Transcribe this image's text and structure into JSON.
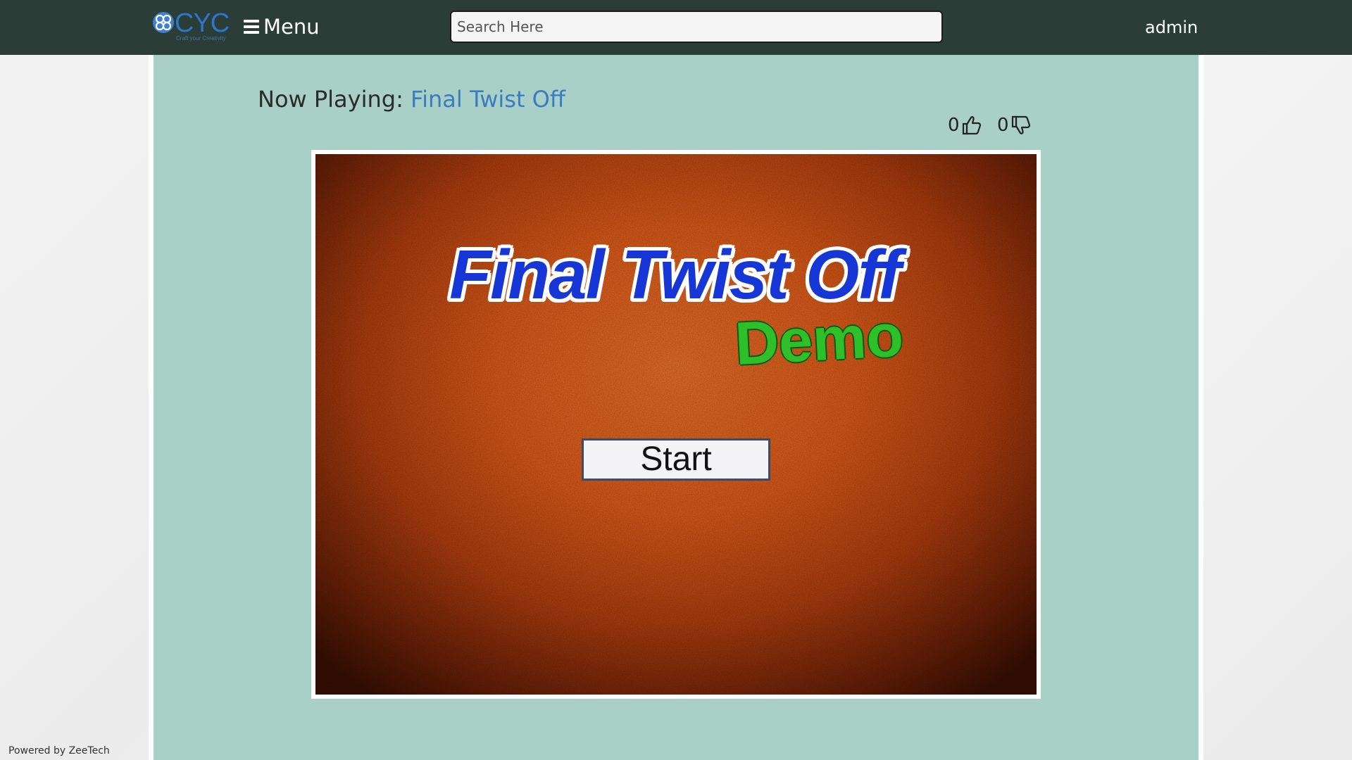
{
  "navbar": {
    "logo_text": "CYC",
    "logo_tagline": "Craft your Creativity",
    "menu_label": "Menu",
    "search_placeholder": "Search Here",
    "search_value": "",
    "user_name": "admin"
  },
  "player": {
    "now_playing_label": "Now Playing: ",
    "game_title": "Final Twist Off",
    "likes": "0",
    "dislikes": "0"
  },
  "game_screen": {
    "title": "Final Twist Off",
    "subtitle": "Demo",
    "start_button": "Start"
  },
  "footer": {
    "powered_by": "Powered by ZeeTech"
  },
  "colors": {
    "navbar": "#2a3d36",
    "content_bg": "#a9d0c6",
    "link": "#3b7bbf",
    "game_title": "#1636d6",
    "game_subtitle": "#2fbf2a"
  },
  "icons": {
    "logo": "flower-logo-icon",
    "menu": "hamburger-icon",
    "like": "thumbs-up-icon",
    "dislike": "thumbs-down-icon"
  }
}
